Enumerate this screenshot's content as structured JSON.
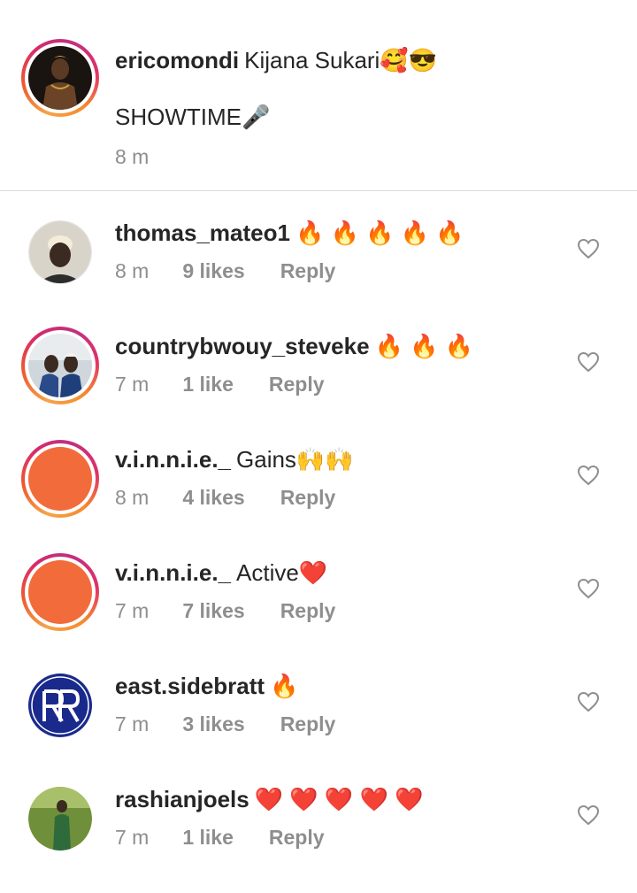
{
  "caption": {
    "username": "ericomondi",
    "text": "Kijana Sukari🥰😎",
    "line2": "SHOWTIME🎤",
    "time": "8 m"
  },
  "comments": [
    {
      "username": "thomas_mateo1",
      "text": "🔥 🔥 🔥 🔥 🔥",
      "time": "8 m",
      "likes": "9 likes",
      "reply": "Reply"
    },
    {
      "username": "countrybwouy_steveke",
      "text": "🔥 🔥 🔥",
      "time": "7 m",
      "likes": "1 like",
      "reply": "Reply"
    },
    {
      "username": "v.i.n.n.i.e._",
      "text": "Gains🙌🙌",
      "time": "8 m",
      "likes": "4 likes",
      "reply": "Reply"
    },
    {
      "username": "v.i.n.n.i.e._",
      "text": "Active❤️",
      "time": "7 m",
      "likes": "7 likes",
      "reply": "Reply"
    },
    {
      "username": "east.sidebratt",
      "text": "🔥",
      "time": "7 m",
      "likes": "3 likes",
      "reply": "Reply"
    },
    {
      "username": "rashianjoels",
      "text": "❤️ ❤️ ❤️ ❤️ ❤️",
      "time": "7 m",
      "likes": "1 like",
      "reply": "Reply"
    }
  ],
  "colors": {
    "accent_orange": "#f26b3a",
    "muted": "#8e8e8e",
    "text": "#262626",
    "heart_outline": "#8e8e8e"
  },
  "icons": {
    "like": "heart-outline-icon"
  }
}
